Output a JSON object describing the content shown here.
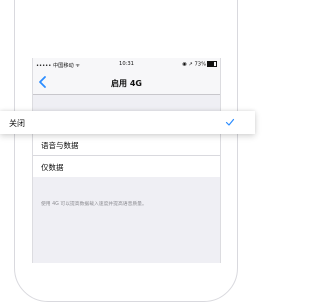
{
  "status_bar": {
    "carrier": "••••• 中国移动 ",
    "wifi": "ᯤ",
    "time": "10:31",
    "right": "◉ ↗ 73%"
  },
  "nav": {
    "back_icon": "chevron-left-icon",
    "title": "启用 4G"
  },
  "options": [
    {
      "label": "关闭",
      "selected": true
    },
    {
      "label": "语音与数据",
      "selected": false
    },
    {
      "label": "仅数据",
      "selected": false
    }
  ],
  "footnote": "使用 4G 可以提高数据载入速度并提高语音质量。",
  "colors": {
    "accent": "#2b8cff",
    "screen_bg": "#efeff4"
  }
}
